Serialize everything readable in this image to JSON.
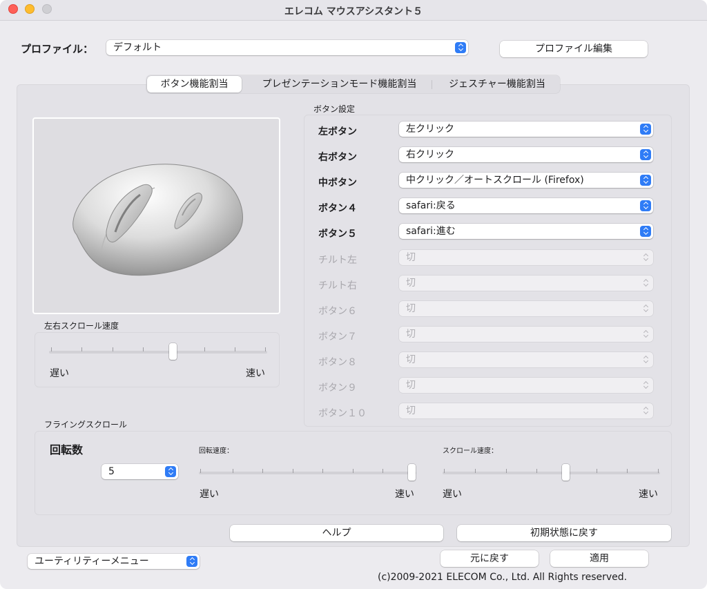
{
  "window": {
    "title": "エレコム マウスアシスタント５"
  },
  "profile": {
    "label": "プロファイル：",
    "value": "デフォルト",
    "edit_button": "プロファイル編集"
  },
  "tabs": [
    {
      "label": "ボタン機能割当",
      "active": true
    },
    {
      "label": "プレゼンテーションモード機能割当",
      "active": false
    },
    {
      "label": "ジェスチャー機能割当",
      "active": false
    }
  ],
  "button_settings": {
    "title": "ボタン設定",
    "rows": [
      {
        "label": "左ボタン",
        "value": "左クリック",
        "enabled": true
      },
      {
        "label": "右ボタン",
        "value": "右クリック",
        "enabled": true
      },
      {
        "label": "中ボタン",
        "value": "中クリック／オートスクロール (Firefox)",
        "enabled": true
      },
      {
        "label": "ボタン４",
        "value": "safari:戻る",
        "enabled": true
      },
      {
        "label": "ボタン５",
        "value": "safari:進む",
        "enabled": true
      },
      {
        "label": "チルト左",
        "value": "切",
        "enabled": false
      },
      {
        "label": "チルト右",
        "value": "切",
        "enabled": false
      },
      {
        "label": "ボタン６",
        "value": "切",
        "enabled": false
      },
      {
        "label": "ボタン７",
        "value": "切",
        "enabled": false
      },
      {
        "label": "ボタン８",
        "value": "切",
        "enabled": false
      },
      {
        "label": "ボタン９",
        "value": "切",
        "enabled": false
      },
      {
        "label": "ボタン１０",
        "value": "切",
        "enabled": false
      }
    ]
  },
  "horizontal_scroll": {
    "title": "左右スクロール速度",
    "slow": "遅い",
    "fast": "速い",
    "level": 0.5
  },
  "flying_scroll": {
    "title": "フライングスクロール",
    "rotations_label": "回転数",
    "rotations_value": "5",
    "rotation_speed_label": "回転速度：",
    "rotation_speed_level": 1.0,
    "scroll_speed_label": "スクロール速度：",
    "scroll_speed_level": 0.57,
    "slow": "遅い",
    "fast": "速い"
  },
  "actions": {
    "help": "ヘルプ",
    "reset_defaults": "初期状態に戻す",
    "revert": "元に戻す",
    "apply": "適用"
  },
  "utility_menu": {
    "value": "ユーティリティーメニュー"
  },
  "copyright": "(c)2009-2021 ELECOM Co., Ltd. All Rights reserved.",
  "colors": {
    "accent": "#2f7cf6",
    "window_bg": "#ecebef"
  }
}
